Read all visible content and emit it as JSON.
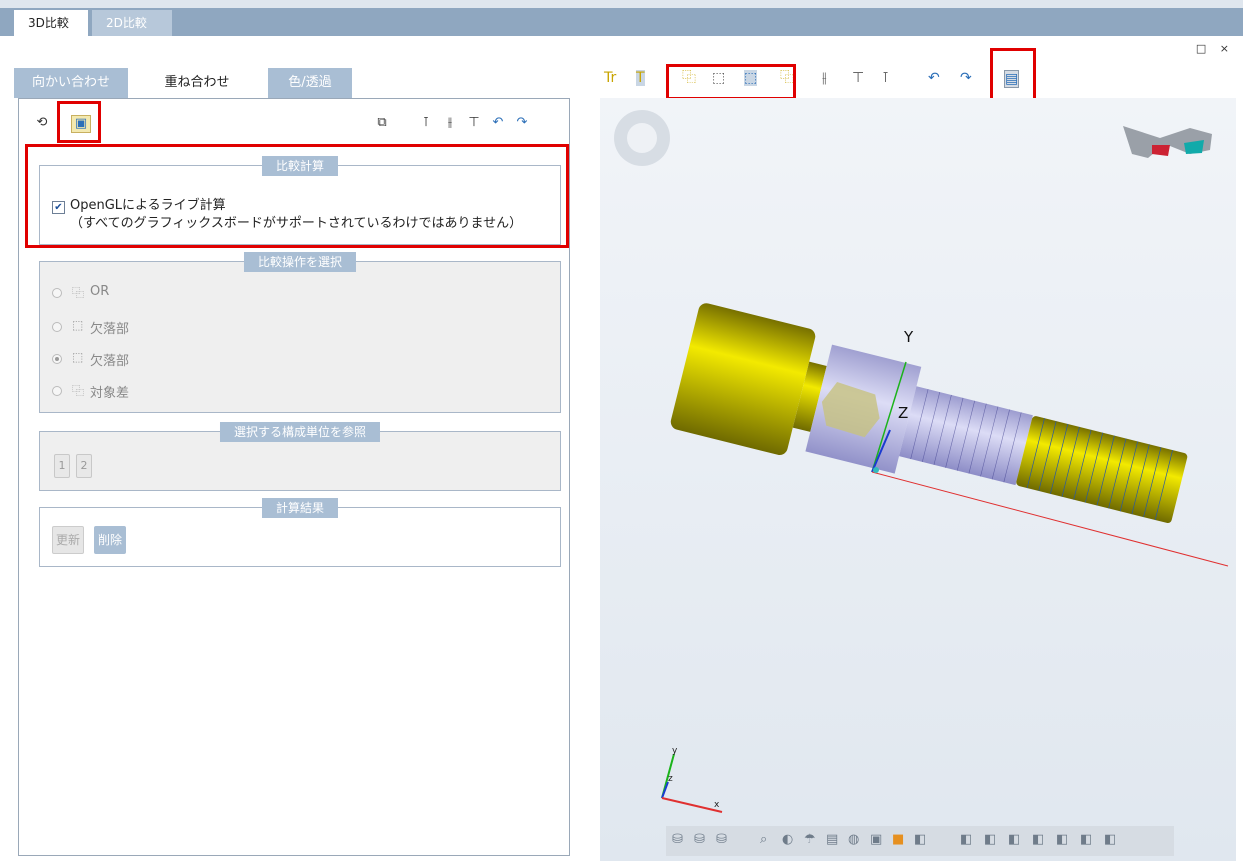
{
  "tabs": {
    "active": "3D比較",
    "inactive": "2D比較"
  },
  "window": {
    "restore_icon": "□",
    "close_icon": "×"
  },
  "left_tabs": [
    "向かい合わせ",
    "重ね合わせ",
    "色/透過"
  ],
  "sections": {
    "calc": {
      "title": "比較計算",
      "checkbox_label": "OpenGLによるライブ計算",
      "checkbox_note": "（すべてのグラフィックスボードがサポートされているわけではありません）",
      "checked": true
    },
    "ops": {
      "title": "比較操作を選択",
      "options": [
        {
          "label": "OR",
          "selected": false
        },
        {
          "label": "欠落部",
          "selected": false
        },
        {
          "label": "欠落部",
          "selected": true
        },
        {
          "label": "対象差",
          "selected": false
        }
      ]
    },
    "units": {
      "title": "選択する構成単位を参照",
      "buttons": [
        "1",
        "2"
      ]
    },
    "results": {
      "title": "計算結果",
      "update": "更新",
      "delete": "削除"
    }
  },
  "viewer": {
    "axes": {
      "y": "Y",
      "z": "Z"
    },
    "triad": {
      "y": "y",
      "z": "z",
      "x": "x"
    }
  },
  "colors": {
    "accent": "#a9bed4",
    "highlight": "#e00000",
    "part_yellow": "#e8e000",
    "part_blue": "#b8b8e8"
  }
}
